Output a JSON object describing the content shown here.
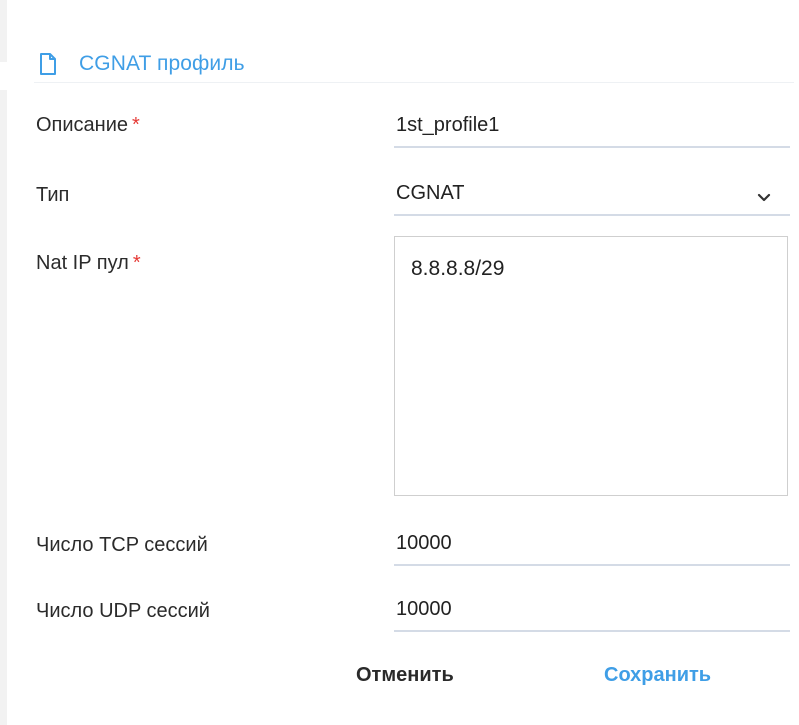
{
  "header": {
    "title": "CGNAT профиль",
    "icon": "document-icon"
  },
  "form": {
    "description": {
      "label": "Описание",
      "required_mark": "*",
      "value": "1st_profile1"
    },
    "type": {
      "label": "Тип",
      "value": "CGNAT",
      "icon": "chevron-down-icon"
    },
    "nat_ip_pool": {
      "label": "Nat IP пул",
      "required_mark": "*",
      "value": "8.8.8.8/29"
    },
    "tcp_sessions": {
      "label": "Число TCP сессий",
      "value": "10000"
    },
    "udp_sessions": {
      "label": "Число UDP сессий",
      "value": "10000"
    }
  },
  "actions": {
    "cancel_label": "Отменить",
    "save_label": "Сохранить"
  },
  "colors": {
    "accent": "#3f9ee6",
    "required": "#e53935",
    "underline": "#d4dbe6"
  }
}
